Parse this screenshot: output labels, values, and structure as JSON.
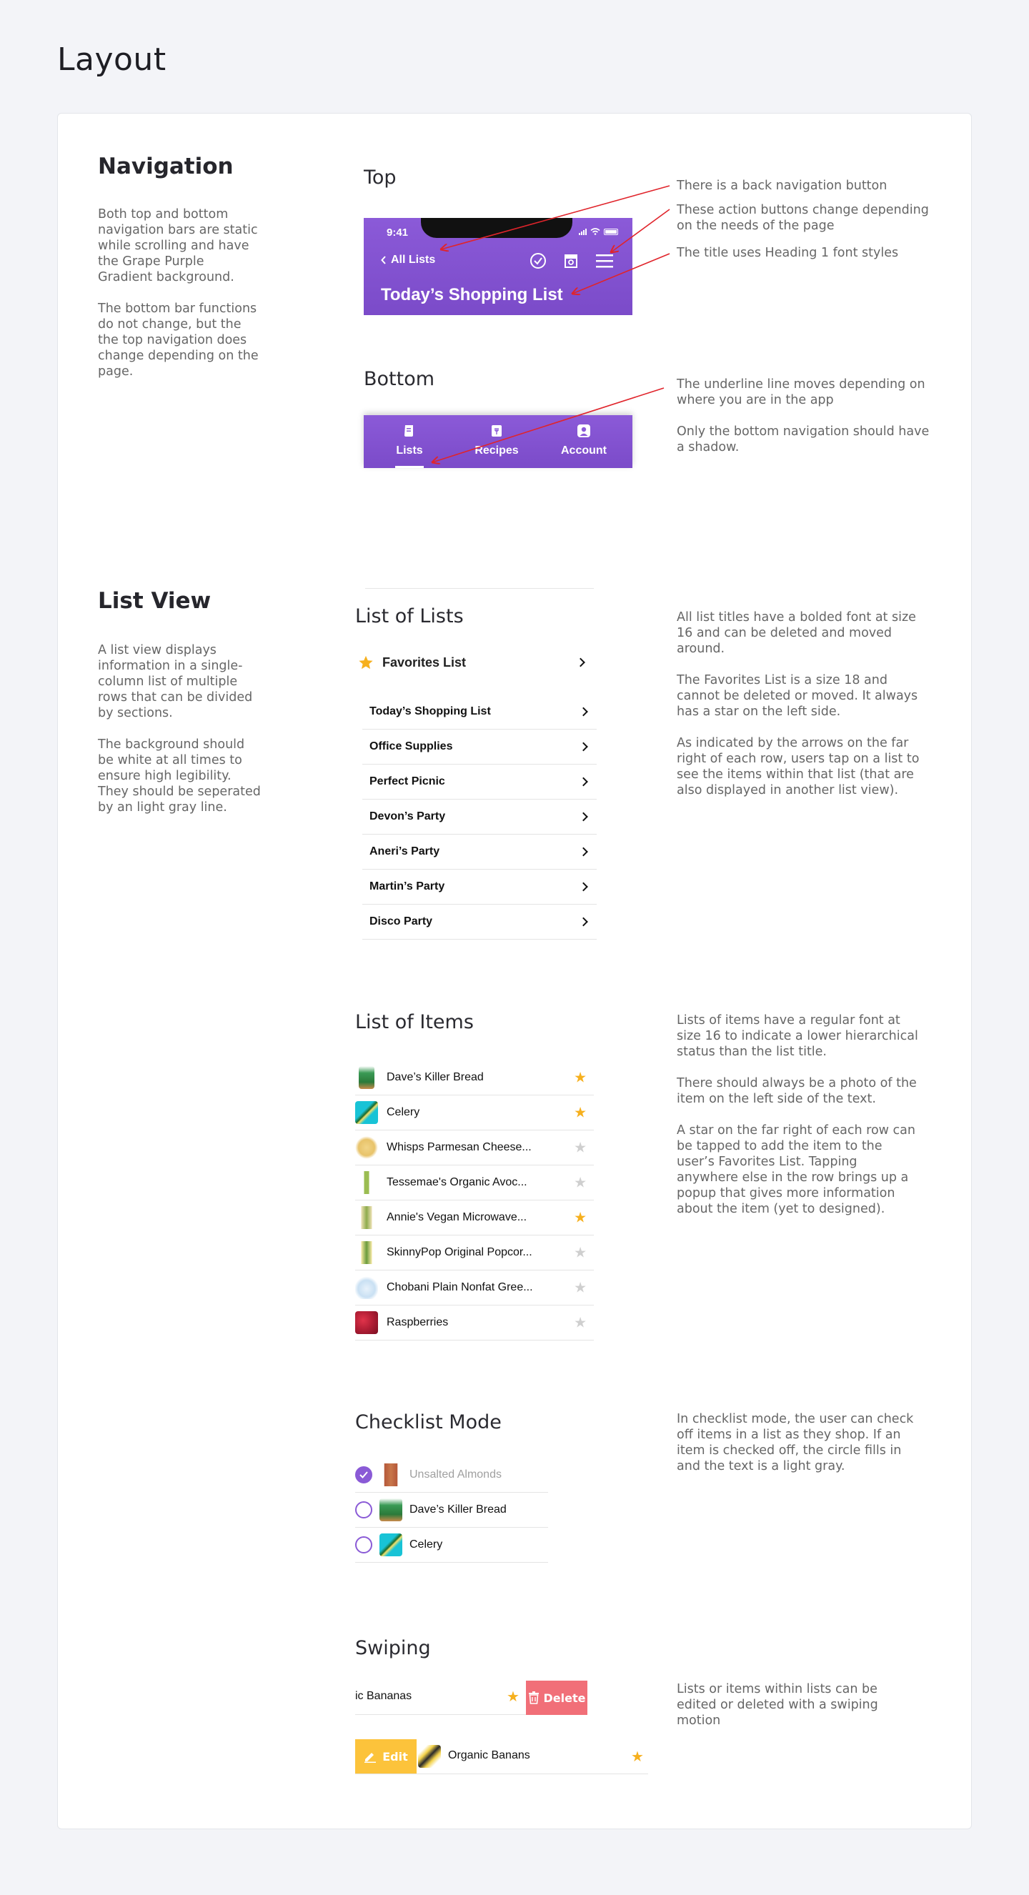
{
  "page_title": "Layout",
  "colors": {
    "grape": "#8b5ad8",
    "star_gold": "#f6b01e",
    "star_gray": "#cfcfcf",
    "delete": "#f16f78",
    "edit": "#fcc33b",
    "arrow": "#e0242b"
  },
  "navigation": {
    "title": "Navigation",
    "desc1": "Both top and bottom navigation bars are static while scrolling and have the Grape Purple Gradient background.",
    "desc2": "The bottom bar functions do not change, but the the top navigation does change depending on the page.",
    "top_label": "Top",
    "topbar": {
      "time": "9:41",
      "back_label": "All Lists",
      "heading": "Today’s Shopping List",
      "actions": [
        "check-circle-icon",
        "store-icon",
        "menu-icon"
      ]
    },
    "top_notes": [
      "There is a back navigation button",
      "These action buttons change depending on the needs of the page",
      "The title uses Heading 1 font styles"
    ],
    "bottom_label": "Bottom",
    "bottombar": {
      "items": [
        {
          "label": "Lists",
          "icon": "list-icon"
        },
        {
          "label": "Recipes",
          "icon": "recipe-icon"
        },
        {
          "label": "Account",
          "icon": "account-icon"
        }
      ]
    },
    "bottom_notes": [
      "The underline line moves depending on where you are in the app",
      "Only the bottom navigation should have a shadow."
    ]
  },
  "list_view": {
    "title": "List View",
    "desc1": "A list view displays information in a single-column list of multiple rows that can be divided by sections.",
    "desc2": "The background should be white at all times to ensure high legibility. They should be seperated by an light gray line.",
    "list_of_lists": {
      "title": "List of Lists",
      "favorites": "Favorites List",
      "rows": [
        "Today’s Shopping List",
        "Office Supplies",
        "Perfect Picnic",
        "Devon’s Party",
        "Aneri’s Party",
        "Martin’s Party",
        "Disco Party"
      ],
      "notes": [
        "All list titles have a bolded font at size 16 and can be deleted and moved around.",
        "The Favorites List is a size 18 and cannot be deleted or moved. It always has a star on the left side.",
        "As indicated by the arrows on the far right of each row, users tap on a list to see the items within that list (that are also displayed in another list view)."
      ]
    },
    "list_of_items": {
      "title": "List of Items",
      "rows": [
        {
          "name": "Dave’s Killer Bread",
          "starred": true
        },
        {
          "name": "Celery",
          "starred": true
        },
        {
          "name": "Whisps Parmesan Cheese...",
          "starred": false
        },
        {
          "name": "Tessemae's Organic Avoc...",
          "starred": false
        },
        {
          "name": "Annie's Vegan Microwave...",
          "starred": true
        },
        {
          "name": "SkinnyPop Original Popcor...",
          "starred": false
        },
        {
          "name": "Chobani Plain Nonfat Gree...",
          "starred": false
        },
        {
          "name": "Raspberries",
          "starred": false
        }
      ],
      "notes": [
        "Lists of items have a regular font at size 16 to indicate a lower hierarchical status than the list title.",
        "There should always be a photo of the item on the left side of the text.",
        "A star on the far right of each row can be tapped to add the item to the user’s Favorites List. Tapping anywhere else in the row brings up a popup that gives more information about the item (yet to designed)."
      ]
    },
    "checklist": {
      "title": "Checklist Mode",
      "rows": [
        {
          "name": "Unsalted Almonds",
          "checked": true
        },
        {
          "name": "Dave’s Killer Bread",
          "checked": false
        },
        {
          "name": "Celery",
          "checked": false
        }
      ],
      "note": "In checklist mode, the user can check off items in a list as they shop. If an item is checked off, the circle fills in and the text is a light gray."
    },
    "swiping": {
      "title": "Swiping",
      "row1_text": "ic Bananas",
      "delete_label": "Delete",
      "edit_label": "Edit",
      "row2_text": "Organic Banans",
      "note": "Lists or items within lists can be edited or deleted with a swiping motion"
    }
  }
}
